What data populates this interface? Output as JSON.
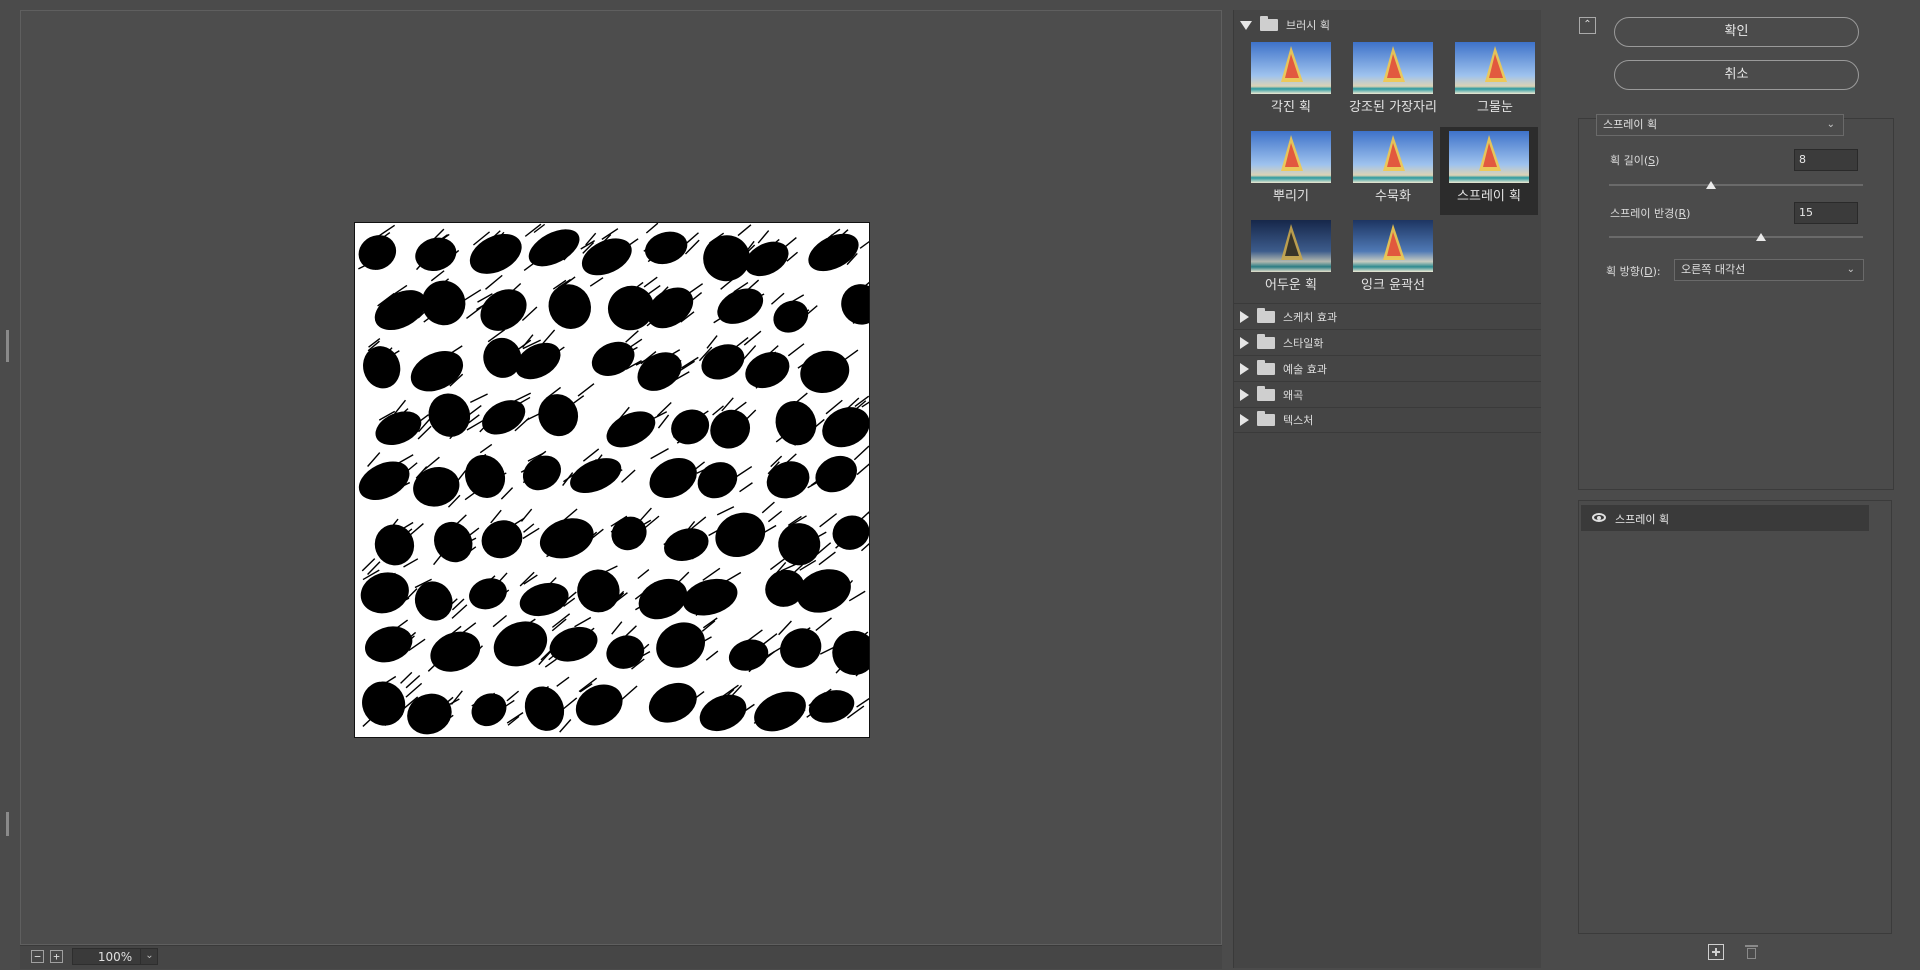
{
  "preview": {
    "zoom": "100%",
    "zoom_out": "−",
    "zoom_in": "+",
    "zoom_dropdown": "⌄"
  },
  "gallery": {
    "open_category": "브러시 획",
    "thumbnails": [
      {
        "label": "각진 획"
      },
      {
        "label": "강조된 가장자리"
      },
      {
        "label": "그물눈"
      },
      {
        "label": "뿌리기"
      },
      {
        "label": "수묵화"
      },
      {
        "label": "스프레이 획",
        "selected": true
      },
      {
        "label": "어두운 획"
      },
      {
        "label": "잉크 윤곽선"
      }
    ],
    "categories": [
      "스케치 효과",
      "스타일화",
      "예술 효과",
      "왜곡",
      "텍스처"
    ]
  },
  "panel": {
    "collapse_icon": "⌃",
    "ok_label": "확인",
    "cancel_label": "취소",
    "filter_select": "스프레이 획",
    "stroke_length_label": "획 길이(",
    "stroke_length_key": "S",
    "stroke_length_value": "8",
    "stroke_length_level": 0.4,
    "spray_radius_label": "스프레이 반경(",
    "spray_radius_key": "R",
    "spray_radius_value": "15",
    "spray_radius_level": 0.6,
    "direction_label": "획 방향(",
    "direction_key": "D",
    "direction_value": "오른쪽 대각선",
    "close_paren": "):",
    "close_paren2": ")",
    "layer_name": "스프레이 획"
  },
  "colors": {
    "background": "#4b4b4b",
    "selected_thumb": "#2c2c2c",
    "canvas": "#ffffff",
    "spots": "#000000"
  }
}
